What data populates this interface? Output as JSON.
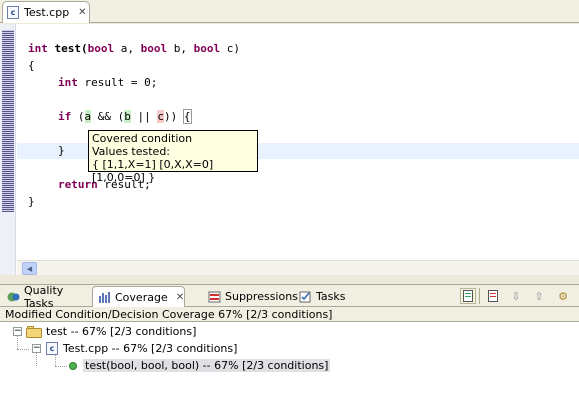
{
  "editor": {
    "tab_label": "Test.cpp",
    "file_icon_letter": "c",
    "code": {
      "l1_kw1": "int",
      "l1_name": " test(",
      "l1_kw2": "bool",
      "l1_a": " a, ",
      "l1_kw3": "bool",
      "l1_b": " b, ",
      "l1_kw4": "bool",
      "l1_c": " c)",
      "l2": "{",
      "l3_kw": "int",
      "l3_rest": " result = 0;",
      "l4_kw": "if",
      "l4_p1": " (",
      "l4_a": "a",
      "l4_and": " && (",
      "l4_b": "b",
      "l4_or": " || ",
      "l4_c": "c",
      "l4_end": ")) ",
      "l4_brace": "{",
      "l5": "}",
      "l6_kw": "return",
      "l6_rest": " result;",
      "l7": "}"
    },
    "tooltip": {
      "title": "Covered condition",
      "subtitle": "Values tested:",
      "values": "{ [1,1,X=1] [0,X,X=0] [1,0,0=0] }"
    }
  },
  "views": {
    "tabs": [
      {
        "label": "Quality Tasks",
        "icon": "quality-tasks-icon"
      },
      {
        "label": "Coverage",
        "icon": "coverage-icon",
        "active": true
      },
      {
        "label": "Suppressions",
        "icon": "suppressions-icon"
      },
      {
        "label": "Tasks",
        "icon": "tasks-icon"
      }
    ],
    "toolbar": [
      "show-file-icon",
      "show-report-icon",
      "next-arrow-icon",
      "previous-arrow-icon",
      "settings-gear-icon"
    ]
  },
  "coverage": {
    "header": "Modified Condition/Decision Coverage 67% [2/3 conditions]",
    "tree": [
      {
        "label": "test -- 67% [2/3 conditions]",
        "icon": "project-folder-icon"
      },
      {
        "label": "Test.cpp -- 67% [2/3 conditions]",
        "icon": "cpp-file-icon"
      },
      {
        "label": "test(bool, bool, bool) -- 67% [2/3 conditions]",
        "icon": "function-dot-icon",
        "selected": true
      }
    ]
  },
  "colors": {
    "keyword": "#7f0055",
    "covered": "#c6efc6",
    "uncovered": "#f6c8c8",
    "tooltip_bg": "#ffffe1",
    "chrome": "#ece9d8"
  }
}
